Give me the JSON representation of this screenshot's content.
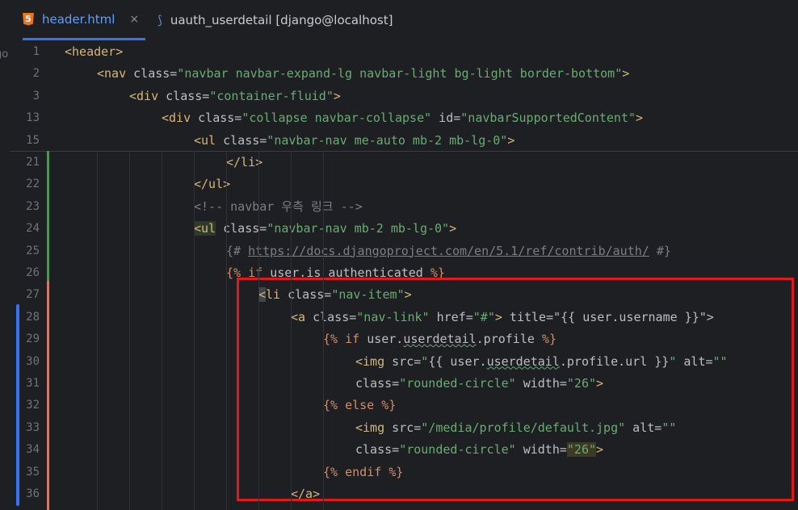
{
  "tabs": [
    {
      "label": "header.html",
      "icon": "html5-icon",
      "close": "×"
    },
    {
      "label": "uauth_userdetail [django@localhost]",
      "icon": "database-icon"
    }
  ],
  "left_fragment": "go",
  "colors": {
    "accent": "#3574f0",
    "highlight_box": "#e0191c",
    "tag": "#d5b778",
    "string": "#6aab73",
    "template": "#cf8e6d"
  },
  "lines": [
    {
      "num": "1",
      "indent": 0,
      "parts": [
        [
          "t-tag",
          "<header>"
        ]
      ]
    },
    {
      "num": "2",
      "indent": 1,
      "parts": [
        [
          "t-tag",
          "<nav "
        ],
        [
          "t-attr",
          "class="
        ],
        [
          "t-str",
          "\"navbar navbar-expand-lg navbar-light bg-light border-bottom\""
        ],
        [
          "t-tag",
          ">"
        ]
      ]
    },
    {
      "num": "3",
      "indent": 2,
      "parts": [
        [
          "t-tag",
          "<div "
        ],
        [
          "t-attr",
          "class="
        ],
        [
          "t-str",
          "\"container-fluid\""
        ],
        [
          "t-tag",
          ">"
        ]
      ]
    },
    {
      "num": "13",
      "indent": 3,
      "parts": [
        [
          "t-tag",
          "<div "
        ],
        [
          "t-attr",
          "class="
        ],
        [
          "t-str",
          "\"collapse navbar-collapse\""
        ],
        [
          "t-attr",
          " id="
        ],
        [
          "t-str",
          "\"navbarSupportedContent\""
        ],
        [
          "t-tag",
          ">"
        ]
      ]
    },
    {
      "num": "15",
      "indent": 4,
      "parts": [
        [
          "t-tag",
          "<ul "
        ],
        [
          "t-attr",
          "class="
        ],
        [
          "t-str",
          "\"navbar-nav me-auto mb-2 mb-lg-0\""
        ],
        [
          "t-tag",
          ">"
        ]
      ]
    },
    {
      "num": "21",
      "indent": 5,
      "parts": [
        [
          "t-tag",
          "</li>"
        ]
      ]
    },
    {
      "num": "22",
      "indent": 4,
      "parts": [
        [
          "t-tag",
          "</ul>"
        ]
      ]
    },
    {
      "num": "23",
      "indent": 4,
      "parts": [
        [
          "t-cmt",
          "<!-- navbar 우측 링크 -->"
        ]
      ]
    },
    {
      "num": "24",
      "indent": 4,
      "parts": [
        [
          "t-tag hl-tag",
          "<ul"
        ],
        [
          "t-attr",
          " class="
        ],
        [
          "t-str",
          "\"navbar-nav mb-2 mb-lg-0\""
        ],
        [
          "t-tag",
          ">"
        ]
      ]
    },
    {
      "num": "25",
      "indent": 5,
      "parts": [
        [
          "t-cmt",
          "{# "
        ],
        [
          "t-link",
          "https://docs.djangoproject.com/en/5.1/ref/contrib/auth/"
        ],
        [
          "t-cmt",
          " #}"
        ]
      ]
    },
    {
      "num": "26",
      "indent": 5,
      "parts": [
        [
          "t-tpl",
          "{% "
        ],
        [
          "t-tpl",
          "if "
        ],
        [
          "t-var",
          "user.is_authenticated "
        ],
        [
          "t-tpl",
          "%}"
        ]
      ]
    },
    {
      "num": "27",
      "indent": 6,
      "parts": [
        [
          "t-tag hl-sel",
          "<"
        ],
        [
          "t-tag",
          "li "
        ],
        [
          "t-attr",
          "class="
        ],
        [
          "t-str",
          "\"nav-item\""
        ],
        [
          "t-tag",
          ">"
        ]
      ]
    },
    {
      "num": "28",
      "indent": 7,
      "parts": [
        [
          "t-tag",
          "<a "
        ],
        [
          "t-attr",
          "class="
        ],
        [
          "t-str",
          "\"nav-link\""
        ],
        [
          "t-attr",
          " href="
        ],
        [
          "t-str",
          "\"#\""
        ],
        [
          "t-tag",
          ">"
        ],
        [
          "t-attr",
          " title=\"{{ user.username }}\">"
        ]
      ]
    },
    {
      "num": "29",
      "indent": 8,
      "parts": [
        [
          "t-tpl",
          "{% "
        ],
        [
          "t-tpl",
          "if "
        ],
        [
          "t-var",
          "user."
        ],
        [
          "t-var t-under",
          "userdetail"
        ],
        [
          "t-var",
          ".profile "
        ],
        [
          "t-tpl",
          "%}"
        ]
      ]
    },
    {
      "num": "30",
      "indent": 9,
      "parts": [
        [
          "t-tag",
          "<img "
        ],
        [
          "t-attr",
          "src="
        ],
        [
          "t-str",
          "\""
        ],
        [
          "t-var",
          "{{ user."
        ],
        [
          "t-var t-under",
          "userdetail"
        ],
        [
          "t-var",
          ".profile.url }}"
        ],
        [
          "t-str",
          "\""
        ],
        [
          "t-attr",
          " alt="
        ],
        [
          "t-str",
          "\"\""
        ]
      ]
    },
    {
      "num": "31",
      "indent": 9,
      "parts": [
        [
          "t-attr",
          "class="
        ],
        [
          "t-str",
          "\"rounded-circle\""
        ],
        [
          "t-attr",
          " width="
        ],
        [
          "t-str",
          "\"26\""
        ],
        [
          "t-tag",
          ">"
        ]
      ]
    },
    {
      "num": "32",
      "indent": 8,
      "parts": [
        [
          "t-tpl",
          "{% "
        ],
        [
          "t-tpl",
          "else "
        ],
        [
          "t-tpl",
          "%}"
        ]
      ]
    },
    {
      "num": "33",
      "indent": 9,
      "parts": [
        [
          "t-tag",
          "<img "
        ],
        [
          "t-attr",
          "src="
        ],
        [
          "t-str",
          "\"/media/profile/default.jpg\""
        ],
        [
          "t-attr",
          " alt="
        ],
        [
          "t-str",
          "\"\""
        ]
      ]
    },
    {
      "num": "34",
      "indent": 9,
      "parts": [
        [
          "t-attr",
          "class="
        ],
        [
          "t-str",
          "\"rounded-circle\""
        ],
        [
          "t-attr",
          " width="
        ],
        [
          "t-str hl-val",
          "\"26\""
        ],
        [
          "t-tag",
          ">"
        ]
      ]
    },
    {
      "num": "35",
      "indent": 8,
      "parts": [
        [
          "t-tpl",
          "{% "
        ],
        [
          "t-tpl",
          "endif "
        ],
        [
          "t-tpl",
          "%}"
        ]
      ]
    },
    {
      "num": "36",
      "indent": 7,
      "parts": [
        [
          "t-tag",
          "</a>"
        ]
      ]
    }
  ]
}
